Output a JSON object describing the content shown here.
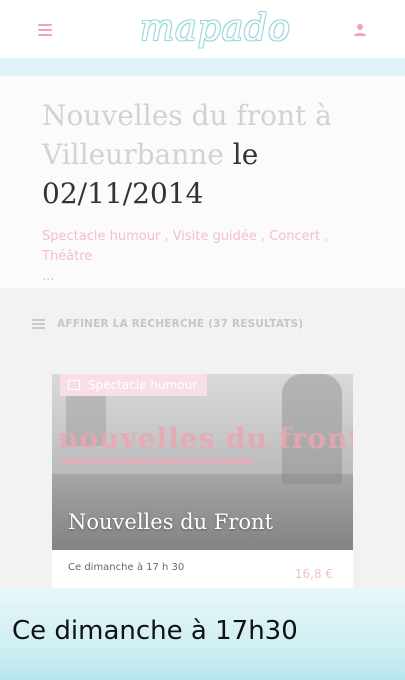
{
  "header": {
    "logo_text": "mapado",
    "menu_icon": "hamburger-menu-icon",
    "user_icon": "user-icon",
    "colors": {
      "accent_pink": "#f1a4b6",
      "logo_teal": "#9fd7e0"
    }
  },
  "hero": {
    "title_part1": "Nouvelles du front à Villeurbanne",
    "title_part2": " le 02/11/2014",
    "categories": "Spectacle humour , Visite guidée , Concert , Théâtre",
    "categories_more": "..."
  },
  "refine": {
    "label": "AFFINER LA RECHERCHE (37 RESULTATS)",
    "icon": "list-icon"
  },
  "card": {
    "badge_label": "Spectacle humour",
    "badge_icon": "theater-icon",
    "title": "Nouvelles du Front",
    "when": "Ce dimanche à 17 h 30",
    "price": "16,8 €"
  },
  "caption": {
    "text": "Ce dimanche à 17h30"
  }
}
